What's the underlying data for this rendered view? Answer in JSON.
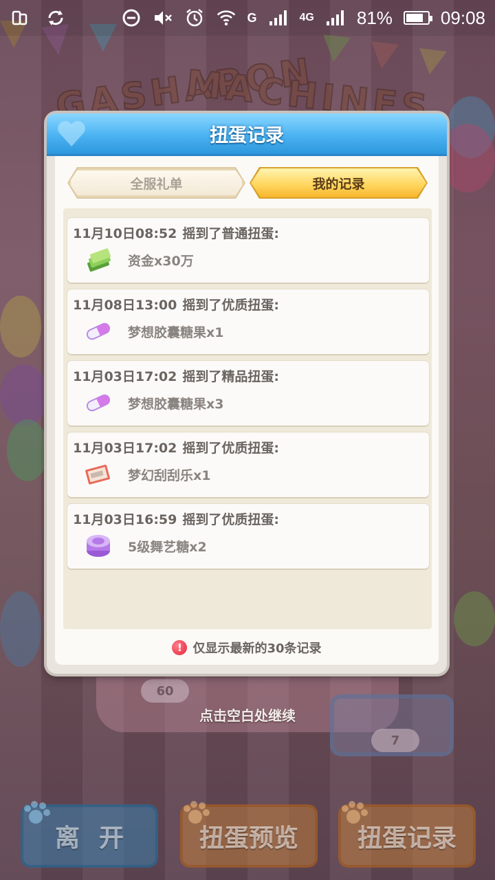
{
  "status_bar": {
    "battery_percent": "81%",
    "battery_level": 0.81,
    "time": "09:08",
    "network_g": "G",
    "network_4g": "4G",
    "icons": [
      "rotate-icon",
      "sync-icon",
      "dnd-icon",
      "mute-icon",
      "alarm-icon",
      "wifi-icon",
      "signal-icon",
      "signal-icon-2",
      "battery-icon"
    ]
  },
  "background": {
    "title_line1": "GASHAPON",
    "title_line2": "MACHINES",
    "machine_count_left": "60",
    "machine_count_right": "7"
  },
  "dialog": {
    "title": "扭蛋记录",
    "tabs": [
      {
        "label": "全服礼单",
        "active": false
      },
      {
        "label": "我的记录",
        "active": true
      }
    ],
    "records": [
      {
        "time": "11月10日08:52",
        "action": "摇到了普通扭蛋:",
        "item": "资金x30万",
        "icon": "money-stack-icon"
      },
      {
        "time": "11月08日13:00",
        "action": "摇到了优质扭蛋:",
        "item": "梦想胶囊糖果x1",
        "icon": "capsule-candy-icon"
      },
      {
        "time": "11月03日17:02",
        "action": "摇到了精品扭蛋:",
        "item": "梦想胶囊糖果x3",
        "icon": "capsule-candy-icon"
      },
      {
        "time": "11月03日17:02",
        "action": "摇到了优质扭蛋:",
        "item": "梦幻刮刮乐x1",
        "icon": "scratch-ticket-icon"
      },
      {
        "time": "11月03日16:59",
        "action": "摇到了优质扭蛋:",
        "item": "5级舞艺糖x2",
        "icon": "dance-candy-icon"
      }
    ],
    "notice_icon_glyph": "!",
    "notice": "仅显示最新的30条记录"
  },
  "continue_hint": "点击空白处继续",
  "bottom_buttons": {
    "leave": "离开",
    "preview": "扭蛋预览",
    "record": "扭蛋记录"
  },
  "colors": {
    "header_blue": "#4bb3f2",
    "active_tab": "#ffd45a",
    "notice_red": "#e3243b"
  }
}
